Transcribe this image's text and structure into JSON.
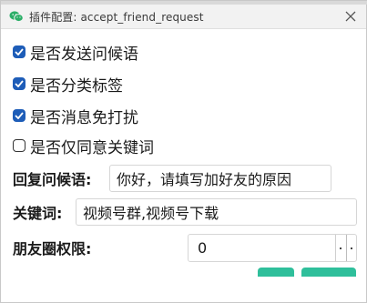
{
  "window": {
    "title": "插件配置: accept_friend_request",
    "app_icon": "wechat-icon",
    "close_icon": "close-icon"
  },
  "options": [
    {
      "label": "是否发送问候语",
      "checked": true
    },
    {
      "label": "是否分类标签",
      "checked": true
    },
    {
      "label": "是否消息免打扰",
      "checked": true
    },
    {
      "label": "是否仅同意关键词",
      "checked": false
    }
  ],
  "fields": {
    "greeting_label": "回复问候语:",
    "greeting_value": "你好，请填写加好友的原因",
    "keywords_label": "关键词:",
    "keywords_value": "视频号群,视频号下载",
    "moments_label": "朋友圈权限:",
    "moments_value": "0"
  },
  "colors": {
    "accent_blue": "#1e5db8",
    "button_green": "#2fbf9b"
  }
}
